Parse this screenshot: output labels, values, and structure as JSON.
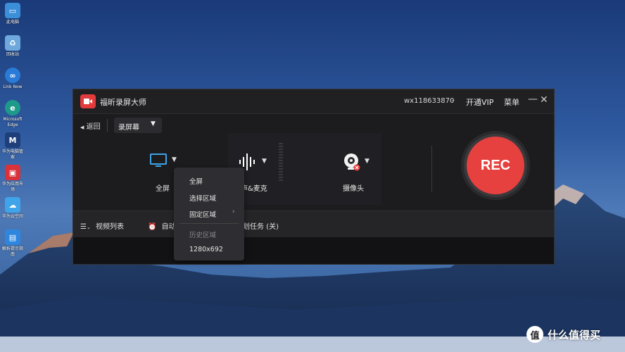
{
  "desktop": {
    "icons": [
      {
        "label": "此电脑",
        "icon": "computer-icon"
      },
      {
        "label": "回收站",
        "icon": "recycle-bin-icon"
      },
      {
        "label": "Link Now",
        "icon": "link-now-icon"
      },
      {
        "label": "Microsoft Edge",
        "icon": "edge-icon"
      },
      {
        "label": "华为电脑管家",
        "icon": "huawei-manager-icon"
      },
      {
        "label": "华为应用市场",
        "icon": "huawei-appgallery-icon"
      },
      {
        "label": "华为云空间",
        "icon": "huawei-cloud-icon"
      },
      {
        "label": "解析提示指南",
        "icon": "guide-icon"
      }
    ]
  },
  "app": {
    "title": "福昕录屏大师",
    "account": "wx118633870",
    "vip": "开通VIP",
    "menu": "菜单",
    "back": "返回",
    "mode_dropdown": "录屏幕",
    "modes": {
      "fullscreen": "全屏",
      "audio": "声&麦克",
      "camera": "摄像头"
    },
    "rec": "REC",
    "footer": {
      "video_list": "视频列表",
      "auto": "自动",
      "task": "划任务 (关)"
    }
  },
  "popup_menu": {
    "items": [
      {
        "label": "全屏",
        "disabled": false
      },
      {
        "label": "选择区域",
        "disabled": false
      },
      {
        "label": "固定区域",
        "disabled": false,
        "submenu": true
      },
      {
        "label": "历史区域",
        "disabled": true
      },
      {
        "label": "1280x692",
        "disabled": false
      }
    ]
  },
  "watermark": {
    "logo": "值",
    "text": "什么值得买"
  },
  "colors": {
    "rec_red": "#e6403f",
    "window_bg": "#1c1c1f",
    "accent_blue": "#3fa4e8"
  }
}
